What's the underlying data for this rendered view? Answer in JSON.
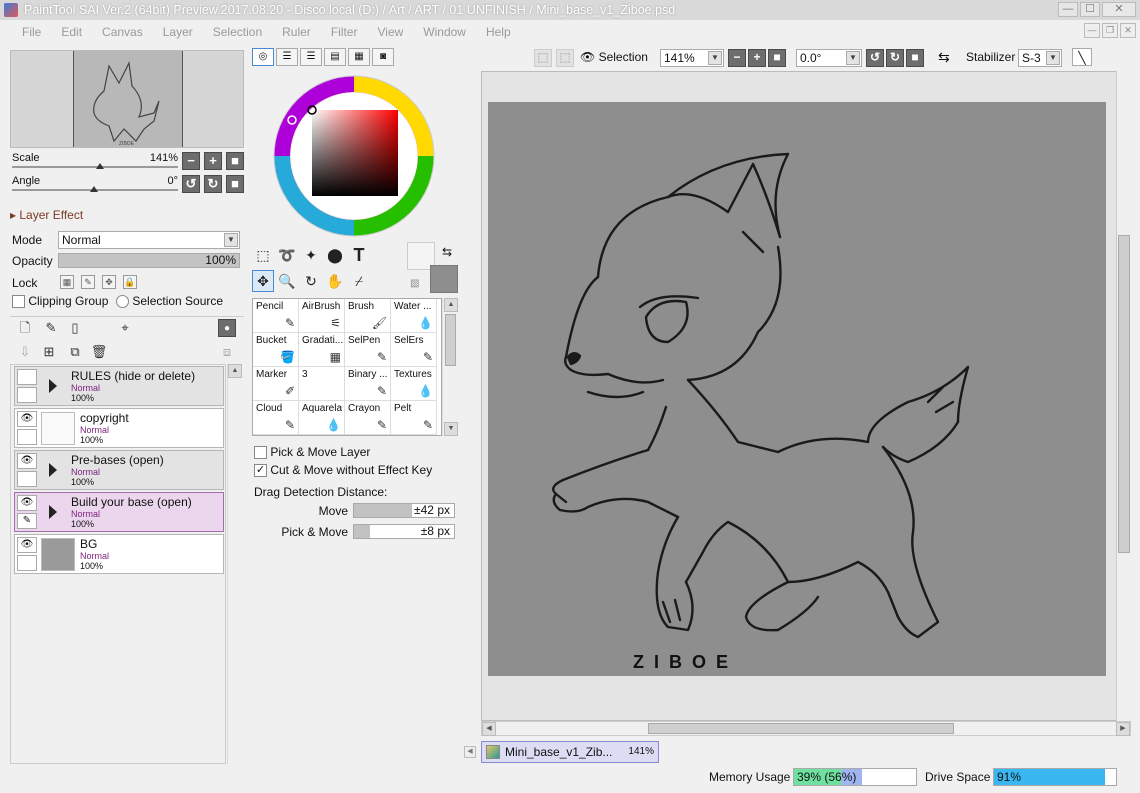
{
  "window": {
    "title": "PaintTool SAI Ver.2 (64bit) Preview.2017.08.20 - Disco local (D:) / Art / ART / 01 UNFINISH / Mini_base_v1_Ziboe.psd",
    "minimize": "—",
    "maximize": "☐",
    "close": "✕"
  },
  "menu": [
    "File",
    "Edit",
    "Canvas",
    "Layer",
    "Selection",
    "Ruler",
    "Filter",
    "View",
    "Window",
    "Help"
  ],
  "navigator": {
    "scale_label": "Scale",
    "scale_value": "141%",
    "angle_label": "Angle",
    "angle_value": "0°"
  },
  "layer_panel": {
    "effect_label": "Layer Effect",
    "mode_label": "Mode",
    "mode_value": "Normal",
    "opacity_label": "Opacity",
    "opacity_value": "100%",
    "lock_label": "Lock",
    "clipping_group": "Clipping Group",
    "selection_source": "Selection Source",
    "layers": [
      {
        "name": "RULES (hide or delete)",
        "mode": "Normal",
        "opacity": "100%",
        "type": "folder"
      },
      {
        "name": "copyright",
        "mode": "Normal",
        "opacity": "100%",
        "type": "layer"
      },
      {
        "name": "Pre-bases (open)",
        "mode": "Normal",
        "opacity": "100%",
        "type": "folder"
      },
      {
        "name": "Build your base (open)",
        "mode": "Normal",
        "opacity": "100%",
        "type": "folder-selected"
      },
      {
        "name": "BG",
        "mode": "Normal",
        "opacity": "100%",
        "type": "layer"
      }
    ]
  },
  "brushes": [
    {
      "name": "Pencil",
      "icon": "✎"
    },
    {
      "name": "AirBrush",
      "icon": "⚟"
    },
    {
      "name": "Brush",
      "icon": "🖌"
    },
    {
      "name": "Water ...",
      "icon": "💧"
    },
    {
      "name": "Bucket",
      "icon": "🪣"
    },
    {
      "name": "Gradati...",
      "icon": "▦"
    },
    {
      "name": "SelPen",
      "icon": "✎"
    },
    {
      "name": "SelErs",
      "icon": "✎"
    },
    {
      "name": "Marker",
      "icon": "✐"
    },
    {
      "name": "3",
      "icon": ""
    },
    {
      "name": "Binary ...",
      "icon": "✎"
    },
    {
      "name": "Textures",
      "icon": "💧"
    },
    {
      "name": "Cloud",
      "icon": "✎"
    },
    {
      "name": "Aquarela",
      "icon": "💧"
    },
    {
      "name": "Crayon",
      "icon": "✎"
    },
    {
      "name": "Pelt",
      "icon": "✎"
    }
  ],
  "tool_options": {
    "pick_move_layer": "Pick & Move Layer",
    "cut_move": "Cut & Move without Effect Key",
    "drag_distance": "Drag Detection Distance:",
    "move_label": "Move",
    "move_value": "±42 px",
    "pick_move_label": "Pick & Move",
    "pick_move_value": "±8 px"
  },
  "canvas_toolbar": {
    "selection": "Selection",
    "zoom": "141%",
    "rotation": "0.0°",
    "stabilizer_label": "Stabilizer",
    "stabilizer_value": "S-3"
  },
  "artwork": {
    "signature": "ZIBOE"
  },
  "document_tab": {
    "name": "Mini_base_v1_Zib...",
    "zoom": "141%"
  },
  "status": {
    "memory_label": "Memory Usage",
    "memory_value": "39% (56%)",
    "memory_fraction": 0.56,
    "drive_label": "Drive Space",
    "drive_value": "91%",
    "drive_fraction": 0.91
  }
}
